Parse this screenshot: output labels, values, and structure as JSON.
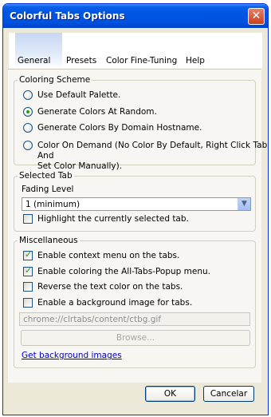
{
  "window": {
    "title": "Colorful Tabs Options",
    "close_icon": "close-icon"
  },
  "tabs": [
    {
      "label": "General",
      "active": true
    },
    {
      "label": "Presets",
      "active": false
    },
    {
      "label": "Color Fine-Tuning",
      "active": false
    },
    {
      "label": "Help",
      "active": false
    }
  ],
  "coloring_scheme": {
    "title": "Coloring Scheme",
    "options": [
      {
        "label": "Use Default Palette.",
        "selected": false
      },
      {
        "label": "Generate Colors At Random.",
        "selected": true
      },
      {
        "label": "Generate Colors By Domain Hostname.",
        "selected": false
      },
      {
        "label_line1": "Color On Demand (No Color By Default, Right Click Tab And",
        "label_line2": "Set Color Manually).",
        "selected": false
      }
    ]
  },
  "selected_tab": {
    "title": "Selected Tab",
    "fading_label": "Fading Level",
    "fading_value": "1 (minimum)",
    "highlight_label": "Highlight the currently selected tab.",
    "highlight_checked": false
  },
  "misc": {
    "title": "Miscellaneous",
    "options": [
      {
        "label": "Enable context menu on the tabs.",
        "checked": true
      },
      {
        "label": "Enable coloring the All-Tabs-Popup menu.",
        "checked": true
      },
      {
        "label": "Reverse the text color on the tabs.",
        "checked": false
      },
      {
        "label": "Enable a background image for tabs.",
        "checked": false
      }
    ],
    "image_path": "chrome://clrtabs/content/ctbg.gif",
    "browse_label": "Browse...",
    "link_label": "Get background images"
  },
  "buttons": {
    "ok": "OK",
    "cancel": "Cancelar"
  }
}
